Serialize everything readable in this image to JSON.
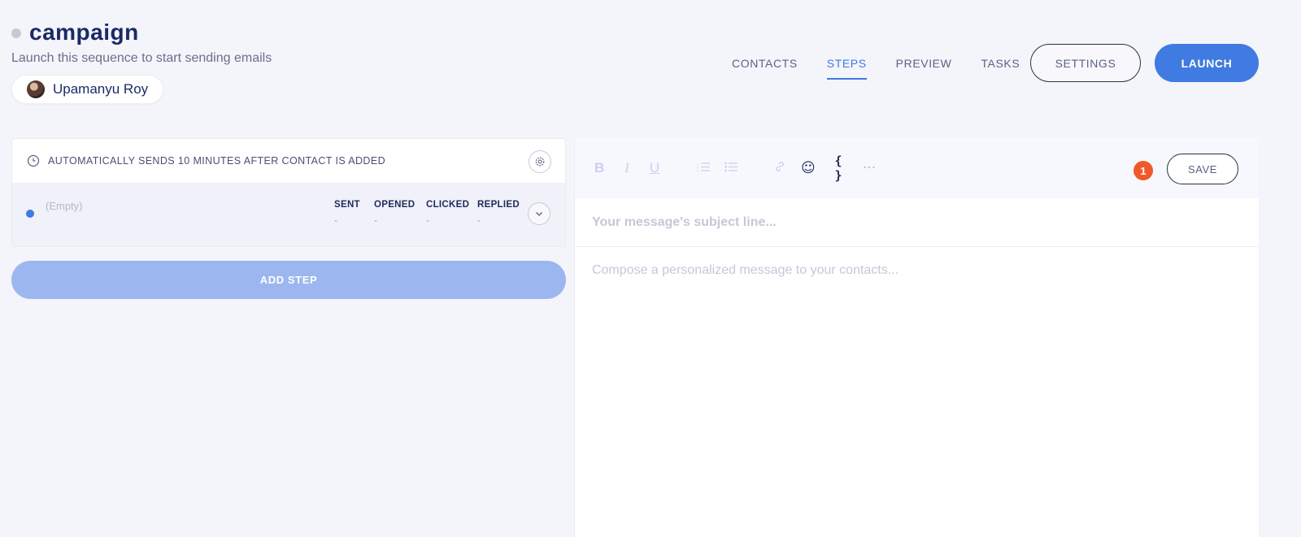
{
  "campaign": {
    "title": "campaign",
    "subtitle": "Launch this sequence to start sending emails",
    "owner": "Upamanyu Roy"
  },
  "nav": {
    "tabs": [
      {
        "label": "CONTACTS",
        "active": false
      },
      {
        "label": "STEPS",
        "active": true
      },
      {
        "label": "PREVIEW",
        "active": false
      },
      {
        "label": "TASKS",
        "active": false
      }
    ],
    "settings_label": "SETTINGS",
    "launch_label": "LAUNCH"
  },
  "step": {
    "schedule_text": "AUTOMATICALLY SENDS 10 MINUTES AFTER CONTACT IS ADDED",
    "name": "(Empty)",
    "stats": [
      {
        "label": "SENT",
        "value": "-"
      },
      {
        "label": "OPENED",
        "value": "-"
      },
      {
        "label": "CLICKED",
        "value": "-"
      },
      {
        "label": "REPLIED",
        "value": "-"
      }
    ],
    "add_step_label": "ADD STEP"
  },
  "editor": {
    "toolbar": {
      "bold": "B",
      "italic": "I",
      "underline": "U",
      "emoji": "☺",
      "variables": "{ }",
      "more": "···"
    },
    "badge_count": "1",
    "save_label": "SAVE",
    "subject_placeholder": "Your message's subject line...",
    "body_placeholder": "Compose a personalized message to your contacts..."
  },
  "colors": {
    "accent": "#3f7be0",
    "badge": "#f2592a",
    "background": "#f4f4fb"
  }
}
